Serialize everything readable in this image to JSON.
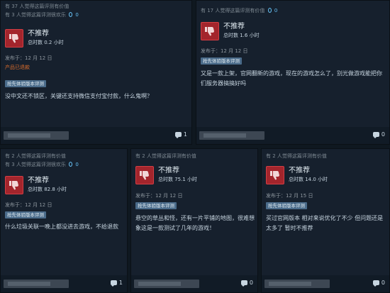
{
  "reviews": [
    {
      "helpful": "有 37 人觉得这篇评测有价值",
      "funny": "有 3 人觉得这篇评测很欢乐",
      "funny_count": "0",
      "verdict": "不推荐",
      "hours": "总时数 0.2 小时",
      "posted": "发布于：12 月 12 日",
      "refund": "产品已退款",
      "early_access": "抢先体验版本评测",
      "text": "没中文还不锁区，关键还支持微信支付宝付款，什么鬼啊？",
      "comments": "1"
    },
    {
      "helpful": "有 17 人觉得这篇评测有价值",
      "funny_count": "0",
      "verdict": "不推荐",
      "hours": "总时数 1.6 小时",
      "posted": "发布于：12 月 12 日",
      "early_access": "抢先体验版本评测",
      "text": "又是一款上架，官网翻新的游戏，现在的游戏怎么了，别光做游戏能把你们服务器搞搞好吗",
      "comments": "0"
    },
    {
      "helpful": "有 2 人觉得这篇评测有价值",
      "funny": "有 3 人觉得这篇评测很欢乐",
      "funny_count": "0",
      "verdict": "不推荐",
      "hours": "总时数 82.8 小时",
      "posted": "发布于：12 月 12 日",
      "early_access": "抢先体验版本评测",
      "text": "什么垃圾关联一晚上都没进去游戏，不给退款",
      "comments": "1"
    },
    {
      "helpful": "有 2 人觉得这篇评测有价值",
      "verdict": "不推荐",
      "hours": "总时数 75.1 小时",
      "posted": "发布于：12 月 12 日",
      "early_access": "抢先体验版本评测",
      "text": "悬空的草丛和怪，还有一片平铺的地图，很难想象这是一款测试了几年的游戏！",
      "comments": "0"
    },
    {
      "helpful": "有 2 人觉得这篇评测有价值",
      "verdict": "不推荐",
      "hours": "总时数 14.0 小时",
      "posted": "发布于：12 月 15 日",
      "early_access": "抢先体验版本评测",
      "text": "买过官网版本 相对来说优化了不少 但问题还是太多了 暂时不推荐",
      "comments": "0"
    }
  ],
  "colors": {
    "background": "#0f1820",
    "card": "#16202d",
    "thumb_down": "#a3252c",
    "refund": "#d96b2b",
    "funny_accent": "#66c0f4",
    "badge": "#4a6b8a"
  },
  "icons": {
    "verdict": "thumbs-down-icon",
    "funny": "funny-icon",
    "comment": "comment-bubble-icon"
  }
}
